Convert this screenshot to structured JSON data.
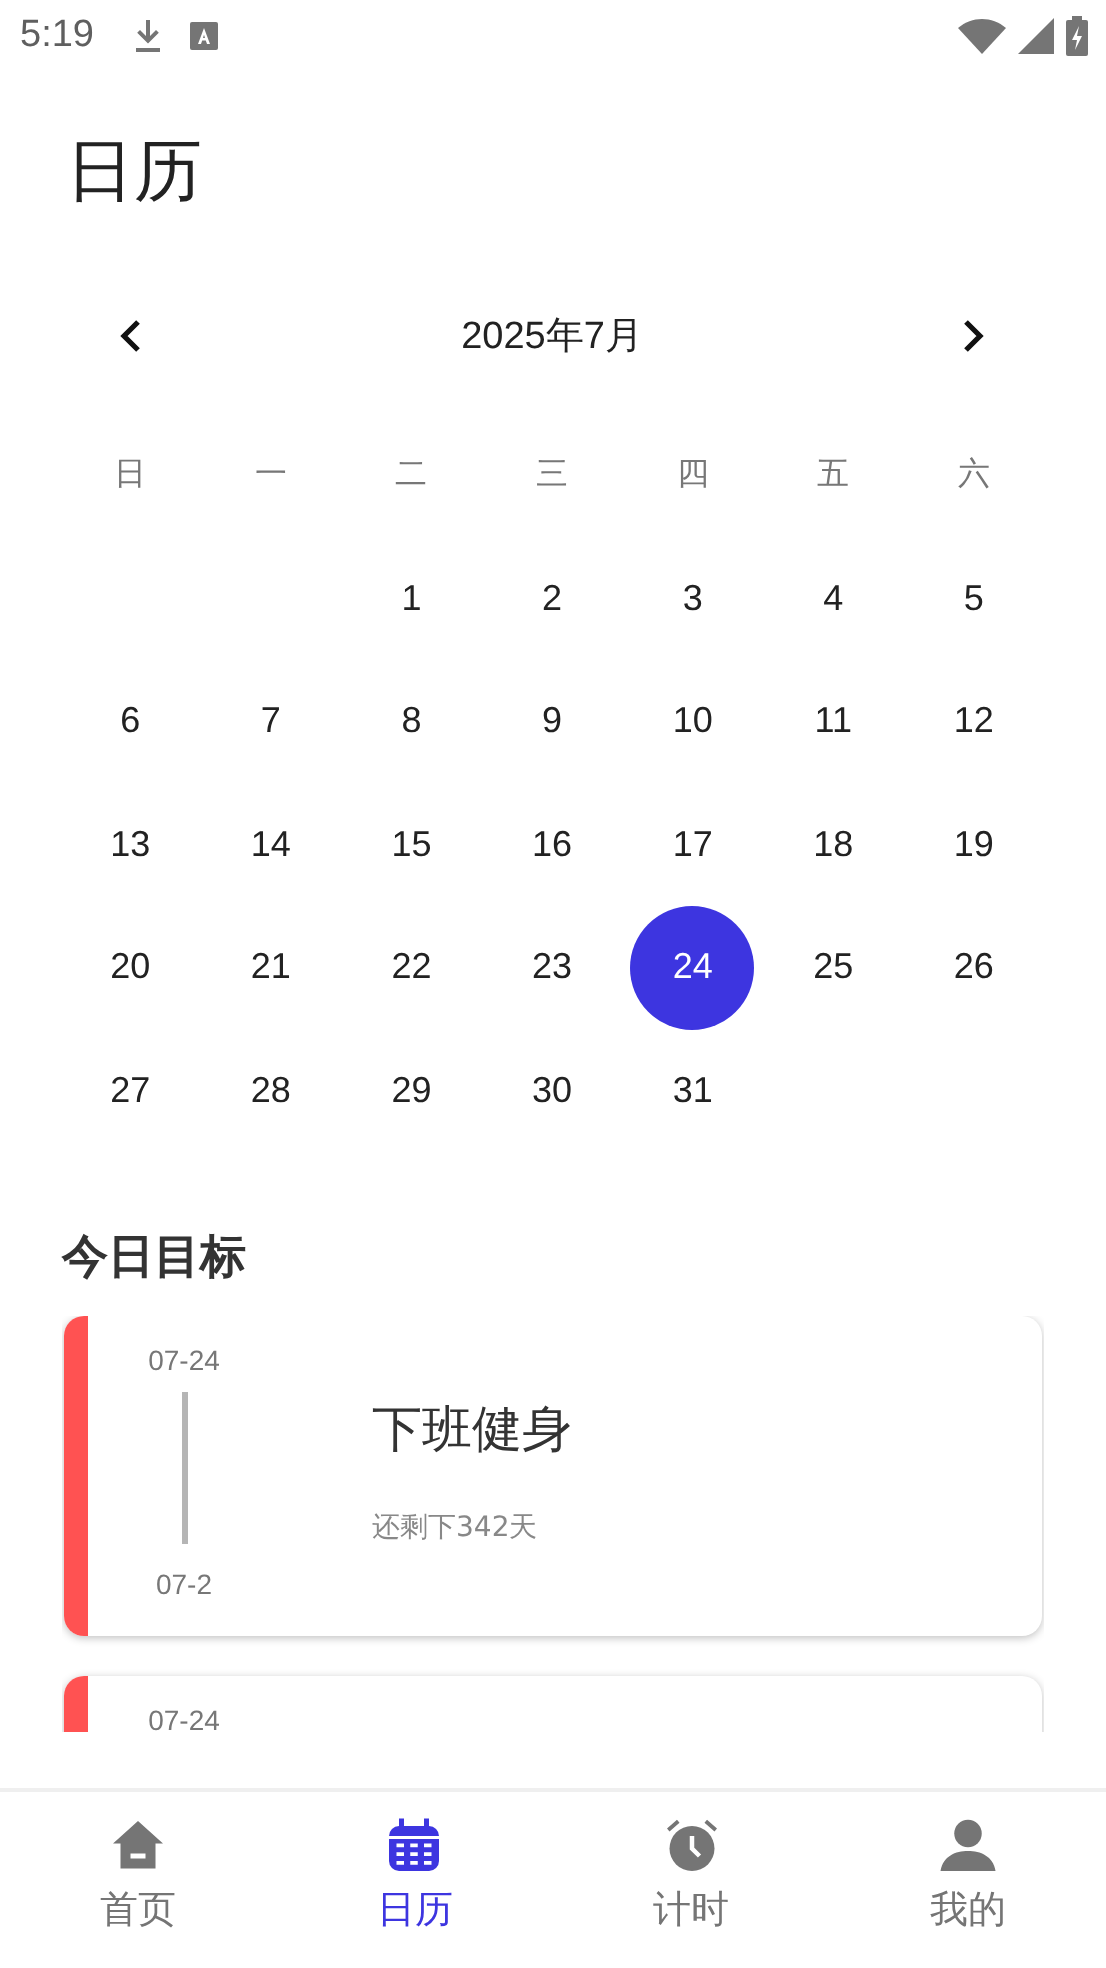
{
  "status_bar": {
    "time": "5:19"
  },
  "header": {
    "title": "日历"
  },
  "calendar": {
    "month_label": "2025年7月",
    "weekdays": [
      "日",
      "一",
      "二",
      "三",
      "四",
      "五",
      "六"
    ],
    "weeks": [
      [
        {
          "kind": "blank"
        },
        {
          "kind": "blank"
        },
        {
          "kind": "day",
          "day": "1",
          "selected": false
        },
        {
          "kind": "day",
          "day": "2",
          "selected": false
        },
        {
          "kind": "day",
          "day": "3",
          "selected": false
        },
        {
          "kind": "day",
          "day": "4",
          "selected": false
        },
        {
          "kind": "day",
          "day": "5",
          "selected": false
        }
      ],
      [
        {
          "kind": "day",
          "day": "6",
          "selected": false
        },
        {
          "kind": "day",
          "day": "7",
          "selected": false
        },
        {
          "kind": "day",
          "day": "8",
          "selected": false
        },
        {
          "kind": "day",
          "day": "9",
          "selected": false
        },
        {
          "kind": "day",
          "day": "10",
          "selected": false
        },
        {
          "kind": "day",
          "day": "11",
          "selected": false
        },
        {
          "kind": "day",
          "day": "12",
          "selected": false
        }
      ],
      [
        {
          "kind": "day",
          "day": "13",
          "selected": false
        },
        {
          "kind": "day",
          "day": "14",
          "selected": false
        },
        {
          "kind": "day",
          "day": "15",
          "selected": false
        },
        {
          "kind": "day",
          "day": "16",
          "selected": false
        },
        {
          "kind": "day",
          "day": "17",
          "selected": false
        },
        {
          "kind": "day",
          "day": "18",
          "selected": false
        },
        {
          "kind": "day",
          "day": "19",
          "selected": false
        }
      ],
      [
        {
          "kind": "day",
          "day": "20",
          "selected": false
        },
        {
          "kind": "day",
          "day": "21",
          "selected": false
        },
        {
          "kind": "day",
          "day": "22",
          "selected": false
        },
        {
          "kind": "day",
          "day": "23",
          "selected": false
        },
        {
          "kind": "day",
          "day": "24",
          "selected": true
        },
        {
          "kind": "day",
          "day": "25",
          "selected": false
        },
        {
          "kind": "day",
          "day": "26",
          "selected": false
        }
      ],
      [
        {
          "kind": "day",
          "day": "27",
          "selected": false
        },
        {
          "kind": "day",
          "day": "28",
          "selected": false
        },
        {
          "kind": "day",
          "day": "29",
          "selected": false
        },
        {
          "kind": "day",
          "day": "30",
          "selected": false
        },
        {
          "kind": "day",
          "day": "31",
          "selected": false
        },
        {
          "kind": "blank"
        },
        {
          "kind": "blank"
        }
      ]
    ]
  },
  "goals": {
    "title": "今日目标",
    "cards": [
      {
        "color": "#ff5252",
        "start": "07-24",
        "end": "07-2",
        "name": "下班健身",
        "remaining": "还剩下342天"
      },
      {
        "color": "#ff5252",
        "start": "07-24"
      }
    ]
  },
  "bottom_nav": [
    {
      "kind": "home",
      "label": "首页",
      "selected": false
    },
    {
      "kind": "calendar",
      "label": "日历",
      "selected": true
    },
    {
      "kind": "clock",
      "label": "计时",
      "selected": false
    },
    {
      "kind": "person",
      "label": "我的",
      "selected": false
    }
  ]
}
